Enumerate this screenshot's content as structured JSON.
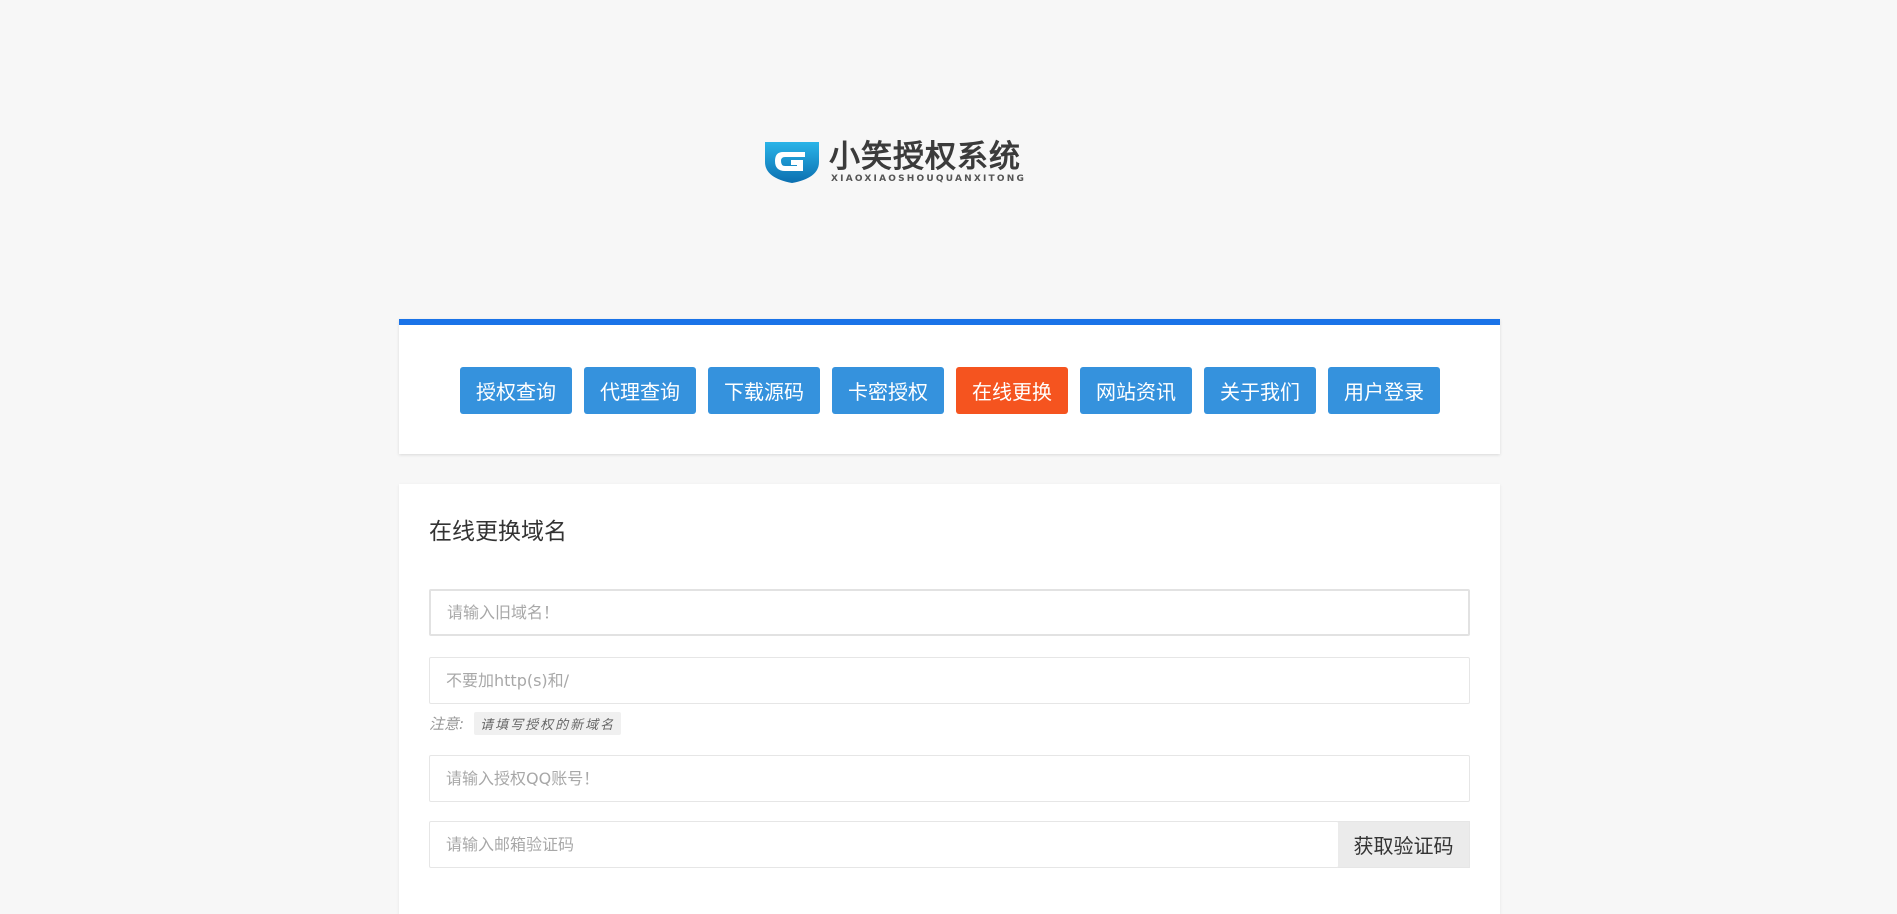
{
  "logo": {
    "title": "小笑授权系统",
    "subtitle": "XIAOXIAOSHOUQUANXITONG",
    "icon": "shield-g-logo-icon"
  },
  "colors": {
    "accent": "#1a73e8",
    "nav_button": "#3592dd",
    "nav_active": "#f5541f"
  },
  "nav": {
    "items": [
      {
        "label": "授权查询"
      },
      {
        "label": "代理查询"
      },
      {
        "label": "下载源码"
      },
      {
        "label": "卡密授权"
      },
      {
        "label": "在线更换",
        "active": true
      },
      {
        "label": "网站资讯"
      },
      {
        "label": "关于我们"
      },
      {
        "label": "用户登录"
      }
    ]
  },
  "form": {
    "title": "在线更换域名",
    "old_domain_placeholder": "请输入旧域名！",
    "new_domain_placeholder": "不要加http(s)和/",
    "note_label": "注意:",
    "note_text": "请填写授权的新域名",
    "qq_placeholder": "请输入授权QQ账号！",
    "email_code_placeholder": "请输入邮箱验证码",
    "get_code_label": "获取验证码"
  }
}
